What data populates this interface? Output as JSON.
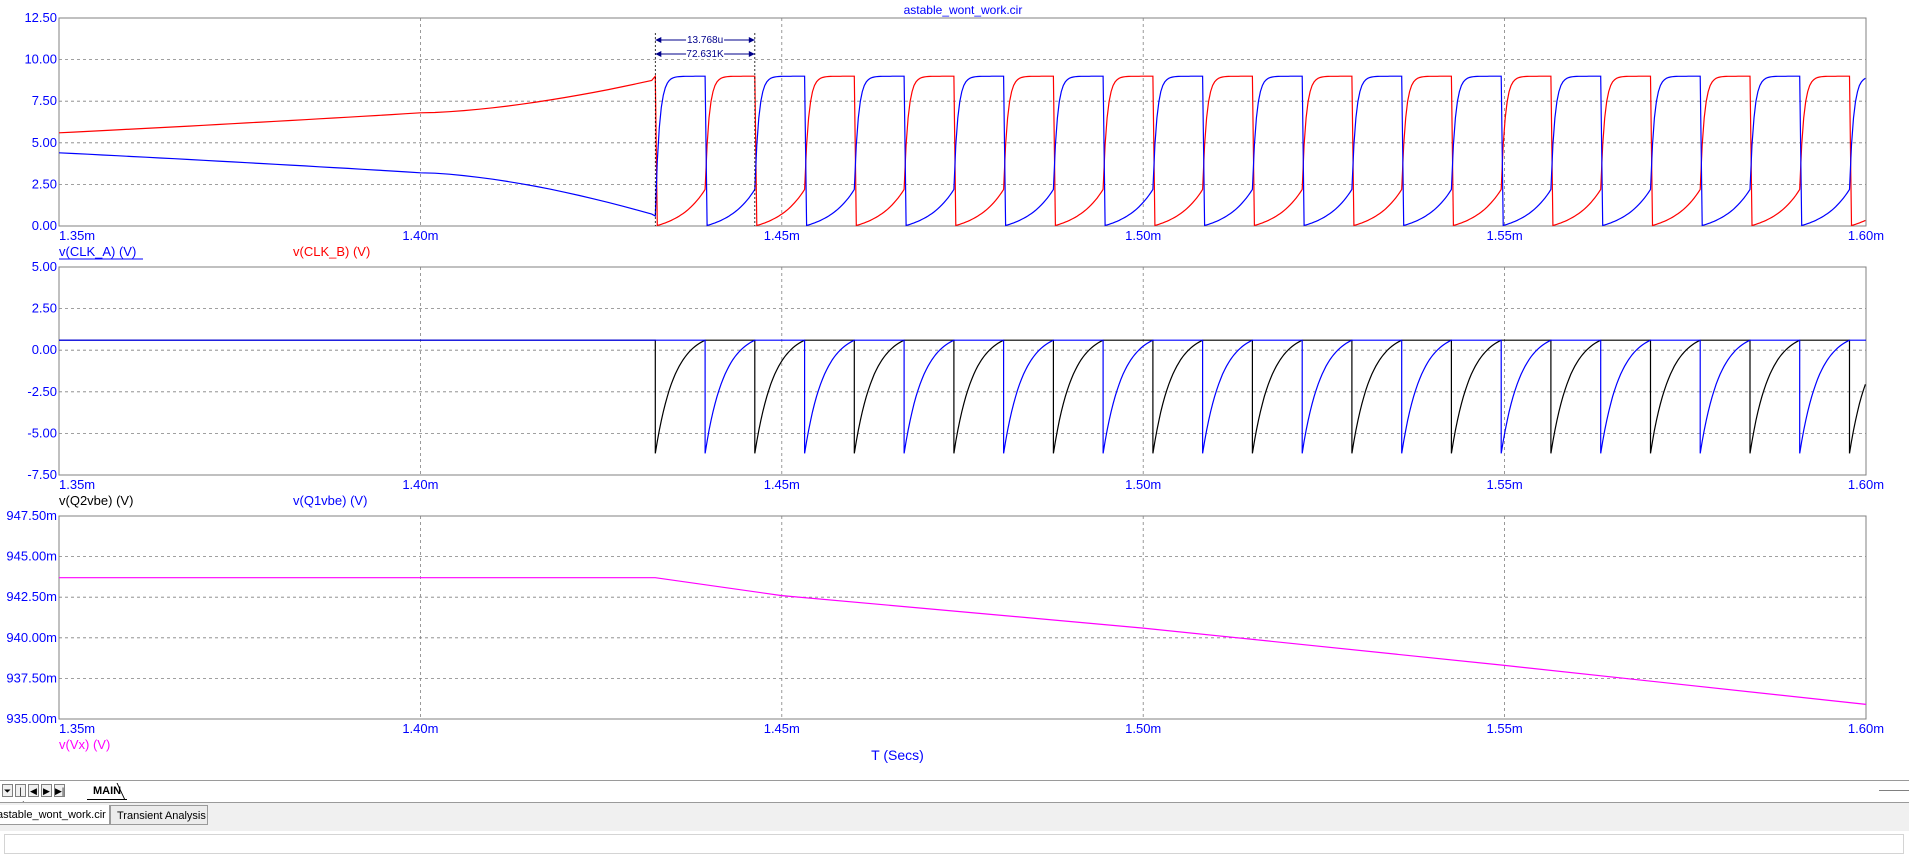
{
  "title": "astable_wont_work.cir",
  "colors": {
    "clk_a": "#0000ff",
    "clk_b": "#ff0000",
    "q2vbe": "#000000",
    "q1vbe": "#0000ff",
    "vx": "#ff00ff",
    "axis_text": "#0000ff",
    "grid": "#808080"
  },
  "chart_data": [
    {
      "type": "line",
      "title": "astable_wont_work.cir",
      "xlabel": "",
      "xlim": [
        1.35,
        1.6
      ],
      "xticks": [
        "1.35m",
        "1.40m",
        "1.45m",
        "1.50m",
        "1.55m",
        "1.60m"
      ],
      "ylim": [
        0,
        12.5
      ],
      "yticks": [
        "12.50",
        "10.00",
        "7.50",
        "5.00",
        "2.50",
        "0.00"
      ],
      "grid": true,
      "legend": [
        "v(CLK_A) (V)",
        "v(CLK_B) (V)"
      ],
      "osc_start_ms": 1.4325,
      "osc_period_us": 13.768,
      "cursor_labels": [
        "13.768u",
        "72.631K"
      ],
      "series": [
        {
          "name": "v(CLK_A) (V)",
          "pre_osc": [
            [
              1.35,
              4.4
            ],
            [
              1.4,
              3.2
            ],
            [
              1.43,
              0.65
            ]
          ],
          "high": 9.0,
          "low": 0.0,
          "start_low_peak": 0.6
        },
        {
          "name": "v(CLK_B) (V)",
          "pre_osc": [
            [
              1.35,
              5.6
            ],
            [
              1.4,
              6.8
            ],
            [
              1.43,
              8.8
            ]
          ],
          "high": 9.0,
          "low": 0.0,
          "start_low_peak": 2.2
        }
      ]
    },
    {
      "type": "line",
      "xlim": [
        1.35,
        1.6
      ],
      "xticks": [
        "1.35m",
        "1.40m",
        "1.45m",
        "1.50m",
        "1.55m",
        "1.60m"
      ],
      "ylim": [
        -7.5,
        5.0
      ],
      "yticks": [
        "5.00",
        "2.50",
        "0.00",
        "-2.50",
        "-5.00",
        "-7.50"
      ],
      "grid": true,
      "legend": [
        "v(Q2vbe) (V)",
        "v(Q1vbe) (V)"
      ],
      "series": [
        {
          "name": "v(Q2vbe) (V)",
          "high": 0.6,
          "min": -6.2
        },
        {
          "name": "v(Q1vbe) (V)",
          "high": 0.6,
          "min": -6.2
        }
      ]
    },
    {
      "type": "line",
      "xlim": [
        1.35,
        1.6
      ],
      "xticks": [
        "1.35m",
        "1.40m",
        "1.45m",
        "1.50m",
        "1.55m",
        "1.60m"
      ],
      "ylim": [
        935.0,
        947.5
      ],
      "yticks": [
        "947.50m",
        "945.00m",
        "942.50m",
        "940.00m",
        "937.50m",
        "935.00m"
      ],
      "grid": true,
      "xlabel": "T (Secs)",
      "legend": [
        "v(Vx) (V)"
      ],
      "series": [
        {
          "name": "v(Vx) (V)",
          "x": [
            1.35,
            1.4325,
            1.45,
            1.5,
            1.55,
            1.6
          ],
          "y": [
            943.7,
            943.7,
            942.6,
            940.6,
            938.3,
            935.9
          ]
        }
      ]
    }
  ],
  "tabs": {
    "nav_buttons": [
      "⏷",
      "|◀",
      "◀",
      "▶",
      "▶|"
    ],
    "sheet_tab": "MAIN",
    "doc_tabs": [
      "astable_wont_work.cir",
      "Transient Analysis"
    ]
  }
}
